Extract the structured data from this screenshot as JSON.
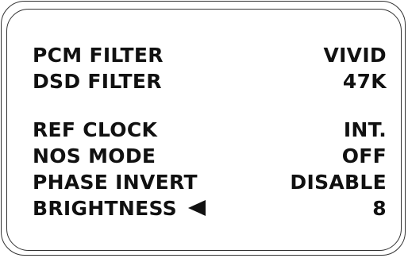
{
  "menu": {
    "items": [
      {
        "label": "PCM FILTER",
        "value": "VIVID"
      },
      {
        "label": "DSD FILTER",
        "value": "47K"
      },
      {
        "label": "REF CLOCK",
        "value": "INT."
      },
      {
        "label": "NOS MODE",
        "value": "OFF"
      },
      {
        "label": "PHASE INVERT",
        "value": "DISABLE"
      },
      {
        "label": "BRIGHTNESS",
        "value": "8"
      }
    ],
    "selected_index": 5,
    "selection_icon": "left-triangle-icon"
  }
}
